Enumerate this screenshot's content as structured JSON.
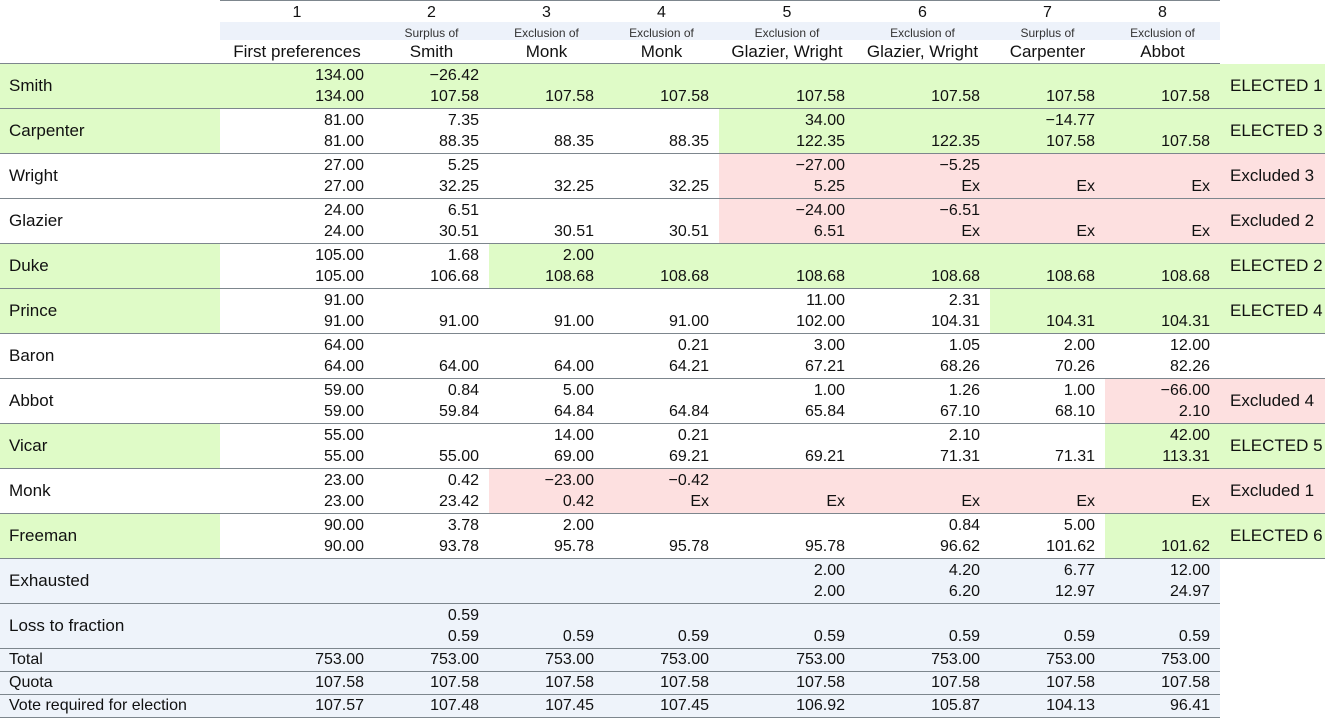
{
  "colors": {
    "elected": "#dffbc7",
    "excluded": "#fde0e0",
    "summary": "#eef3fa"
  },
  "stages": [
    {
      "number": "1",
      "action": "",
      "subject": "First preferences"
    },
    {
      "number": "2",
      "action": "Surplus of",
      "subject": "Smith"
    },
    {
      "number": "3",
      "action": "Exclusion of",
      "subject": "Monk"
    },
    {
      "number": "4",
      "action": "Exclusion of",
      "subject": "Monk"
    },
    {
      "number": "5",
      "action": "Exclusion of",
      "subject": "Glazier, Wright"
    },
    {
      "number": "6",
      "action": "Exclusion of",
      "subject": "Glazier, Wright"
    },
    {
      "number": "7",
      "action": "Surplus of",
      "subject": "Carpenter"
    },
    {
      "number": "8",
      "action": "Exclusion of",
      "subject": "Abbot"
    }
  ],
  "candidates": [
    {
      "name": "Smith",
      "status": "ELECTED 1",
      "state": "elected",
      "highlight_from_stage": 1,
      "name_highlight": true,
      "cells": [
        [
          "134.00",
          "134.00"
        ],
        [
          "−26.42",
          "107.58"
        ],
        [
          "",
          "107.58"
        ],
        [
          "",
          "107.58"
        ],
        [
          "",
          "107.58"
        ],
        [
          "",
          "107.58"
        ],
        [
          "",
          "107.58"
        ],
        [
          "",
          "107.58"
        ]
      ]
    },
    {
      "name": "Carpenter",
      "status": "ELECTED 3",
      "state": "elected",
      "highlight_from_stage": 5,
      "name_highlight": true,
      "cells": [
        [
          "81.00",
          "81.00"
        ],
        [
          "7.35",
          "88.35"
        ],
        [
          "",
          "88.35"
        ],
        [
          "",
          "88.35"
        ],
        [
          "34.00",
          "122.35"
        ],
        [
          "",
          "122.35"
        ],
        [
          "−14.77",
          "107.58"
        ],
        [
          "",
          "107.58"
        ]
      ]
    },
    {
      "name": "Wright",
      "status": "Excluded 3",
      "state": "excluded",
      "highlight_from_stage": 5,
      "name_highlight": false,
      "cells": [
        [
          "27.00",
          "27.00"
        ],
        [
          "5.25",
          "32.25"
        ],
        [
          "",
          "32.25"
        ],
        [
          "",
          "32.25"
        ],
        [
          "−27.00",
          "5.25"
        ],
        [
          "−5.25",
          "Ex"
        ],
        [
          "",
          "Ex"
        ],
        [
          "",
          "Ex"
        ]
      ]
    },
    {
      "name": "Glazier",
      "status": "Excluded 2",
      "state": "excluded",
      "highlight_from_stage": 5,
      "name_highlight": false,
      "cells": [
        [
          "24.00",
          "24.00"
        ],
        [
          "6.51",
          "30.51"
        ],
        [
          "",
          "30.51"
        ],
        [
          "",
          "30.51"
        ],
        [
          "−24.00",
          "6.51"
        ],
        [
          "−6.51",
          "Ex"
        ],
        [
          "",
          "Ex"
        ],
        [
          "",
          "Ex"
        ]
      ]
    },
    {
      "name": "Duke",
      "status": "ELECTED 2",
      "state": "elected",
      "highlight_from_stage": 3,
      "name_highlight": true,
      "cells": [
        [
          "105.00",
          "105.00"
        ],
        [
          "1.68",
          "106.68"
        ],
        [
          "2.00",
          "108.68"
        ],
        [
          "",
          "108.68"
        ],
        [
          "",
          "108.68"
        ],
        [
          "",
          "108.68"
        ],
        [
          "",
          "108.68"
        ],
        [
          "",
          "108.68"
        ]
      ]
    },
    {
      "name": "Prince",
      "status": "ELECTED 4",
      "state": "elected",
      "highlight_from_stage": 7,
      "name_highlight": true,
      "cells": [
        [
          "91.00",
          "91.00"
        ],
        [
          "",
          "91.00"
        ],
        [
          "",
          "91.00"
        ],
        [
          "",
          "91.00"
        ],
        [
          "11.00",
          "102.00"
        ],
        [
          "2.31",
          "104.31"
        ],
        [
          "",
          "104.31"
        ],
        [
          "",
          "104.31"
        ]
      ]
    },
    {
      "name": "Baron",
      "status": "",
      "state": "",
      "highlight_from_stage": null,
      "name_highlight": false,
      "cells": [
        [
          "64.00",
          "64.00"
        ],
        [
          "",
          "64.00"
        ],
        [
          "",
          "64.00"
        ],
        [
          "0.21",
          "64.21"
        ],
        [
          "3.00",
          "67.21"
        ],
        [
          "1.05",
          "68.26"
        ],
        [
          "2.00",
          "70.26"
        ],
        [
          "12.00",
          "82.26"
        ]
      ]
    },
    {
      "name": "Abbot",
      "status": "Excluded 4",
      "state": "excluded",
      "highlight_from_stage": 8,
      "name_highlight": false,
      "cells": [
        [
          "59.00",
          "59.00"
        ],
        [
          "0.84",
          "59.84"
        ],
        [
          "5.00",
          "64.84"
        ],
        [
          "",
          "64.84"
        ],
        [
          "1.00",
          "65.84"
        ],
        [
          "1.26",
          "67.10"
        ],
        [
          "1.00",
          "68.10"
        ],
        [
          "−66.00",
          "2.10"
        ]
      ]
    },
    {
      "name": "Vicar",
      "status": "ELECTED 5",
      "state": "elected",
      "highlight_from_stage": 8,
      "name_highlight": true,
      "cells": [
        [
          "55.00",
          "55.00"
        ],
        [
          "",
          "55.00"
        ],
        [
          "14.00",
          "69.00"
        ],
        [
          "0.21",
          "69.21"
        ],
        [
          "",
          "69.21"
        ],
        [
          "2.10",
          "71.31"
        ],
        [
          "",
          "71.31"
        ],
        [
          "42.00",
          "113.31"
        ]
      ]
    },
    {
      "name": "Monk",
      "status": "Excluded 1",
      "state": "excluded",
      "highlight_from_stage": 3,
      "name_highlight": false,
      "cells": [
        [
          "23.00",
          "23.00"
        ],
        [
          "0.42",
          "23.42"
        ],
        [
          "−23.00",
          "0.42"
        ],
        [
          "−0.42",
          "Ex"
        ],
        [
          "",
          "Ex"
        ],
        [
          "",
          "Ex"
        ],
        [
          "",
          "Ex"
        ],
        [
          "",
          "Ex"
        ]
      ]
    },
    {
      "name": "Freeman",
      "status": "ELECTED 6",
      "state": "elected",
      "highlight_from_stage": 8,
      "name_highlight": true,
      "cells": [
        [
          "90.00",
          "90.00"
        ],
        [
          "3.78",
          "93.78"
        ],
        [
          "2.00",
          "95.78"
        ],
        [
          "",
          "95.78"
        ],
        [
          "",
          "95.78"
        ],
        [
          "0.84",
          "96.62"
        ],
        [
          "5.00",
          "101.62"
        ],
        [
          "",
          "101.62"
        ]
      ]
    }
  ],
  "other_rows": [
    {
      "name": "Exhausted",
      "cells": [
        [
          "",
          ""
        ],
        [
          "",
          ""
        ],
        [
          "",
          ""
        ],
        [
          "",
          ""
        ],
        [
          "2.00",
          "2.00"
        ],
        [
          "4.20",
          "6.20"
        ],
        [
          "6.77",
          "12.97"
        ],
        [
          "12.00",
          "24.97"
        ]
      ]
    },
    {
      "name": "Loss to fraction",
      "cells": [
        [
          "",
          ""
        ],
        [
          "0.59",
          "0.59"
        ],
        [
          "",
          "0.59"
        ],
        [
          "",
          "0.59"
        ],
        [
          "",
          "0.59"
        ],
        [
          "",
          "0.59"
        ],
        [
          "",
          "0.59"
        ],
        [
          "",
          "0.59"
        ]
      ]
    }
  ],
  "summary_rows": [
    {
      "name": "Total",
      "values": [
        "753.00",
        "753.00",
        "753.00",
        "753.00",
        "753.00",
        "753.00",
        "753.00",
        "753.00"
      ]
    },
    {
      "name": "Quota",
      "values": [
        "107.58",
        "107.58",
        "107.58",
        "107.58",
        "107.58",
        "107.58",
        "107.58",
        "107.58"
      ]
    },
    {
      "name": "Vote required for election",
      "values": [
        "107.57",
        "107.48",
        "107.45",
        "107.45",
        "106.92",
        "105.87",
        "104.13",
        "96.41"
      ]
    }
  ]
}
